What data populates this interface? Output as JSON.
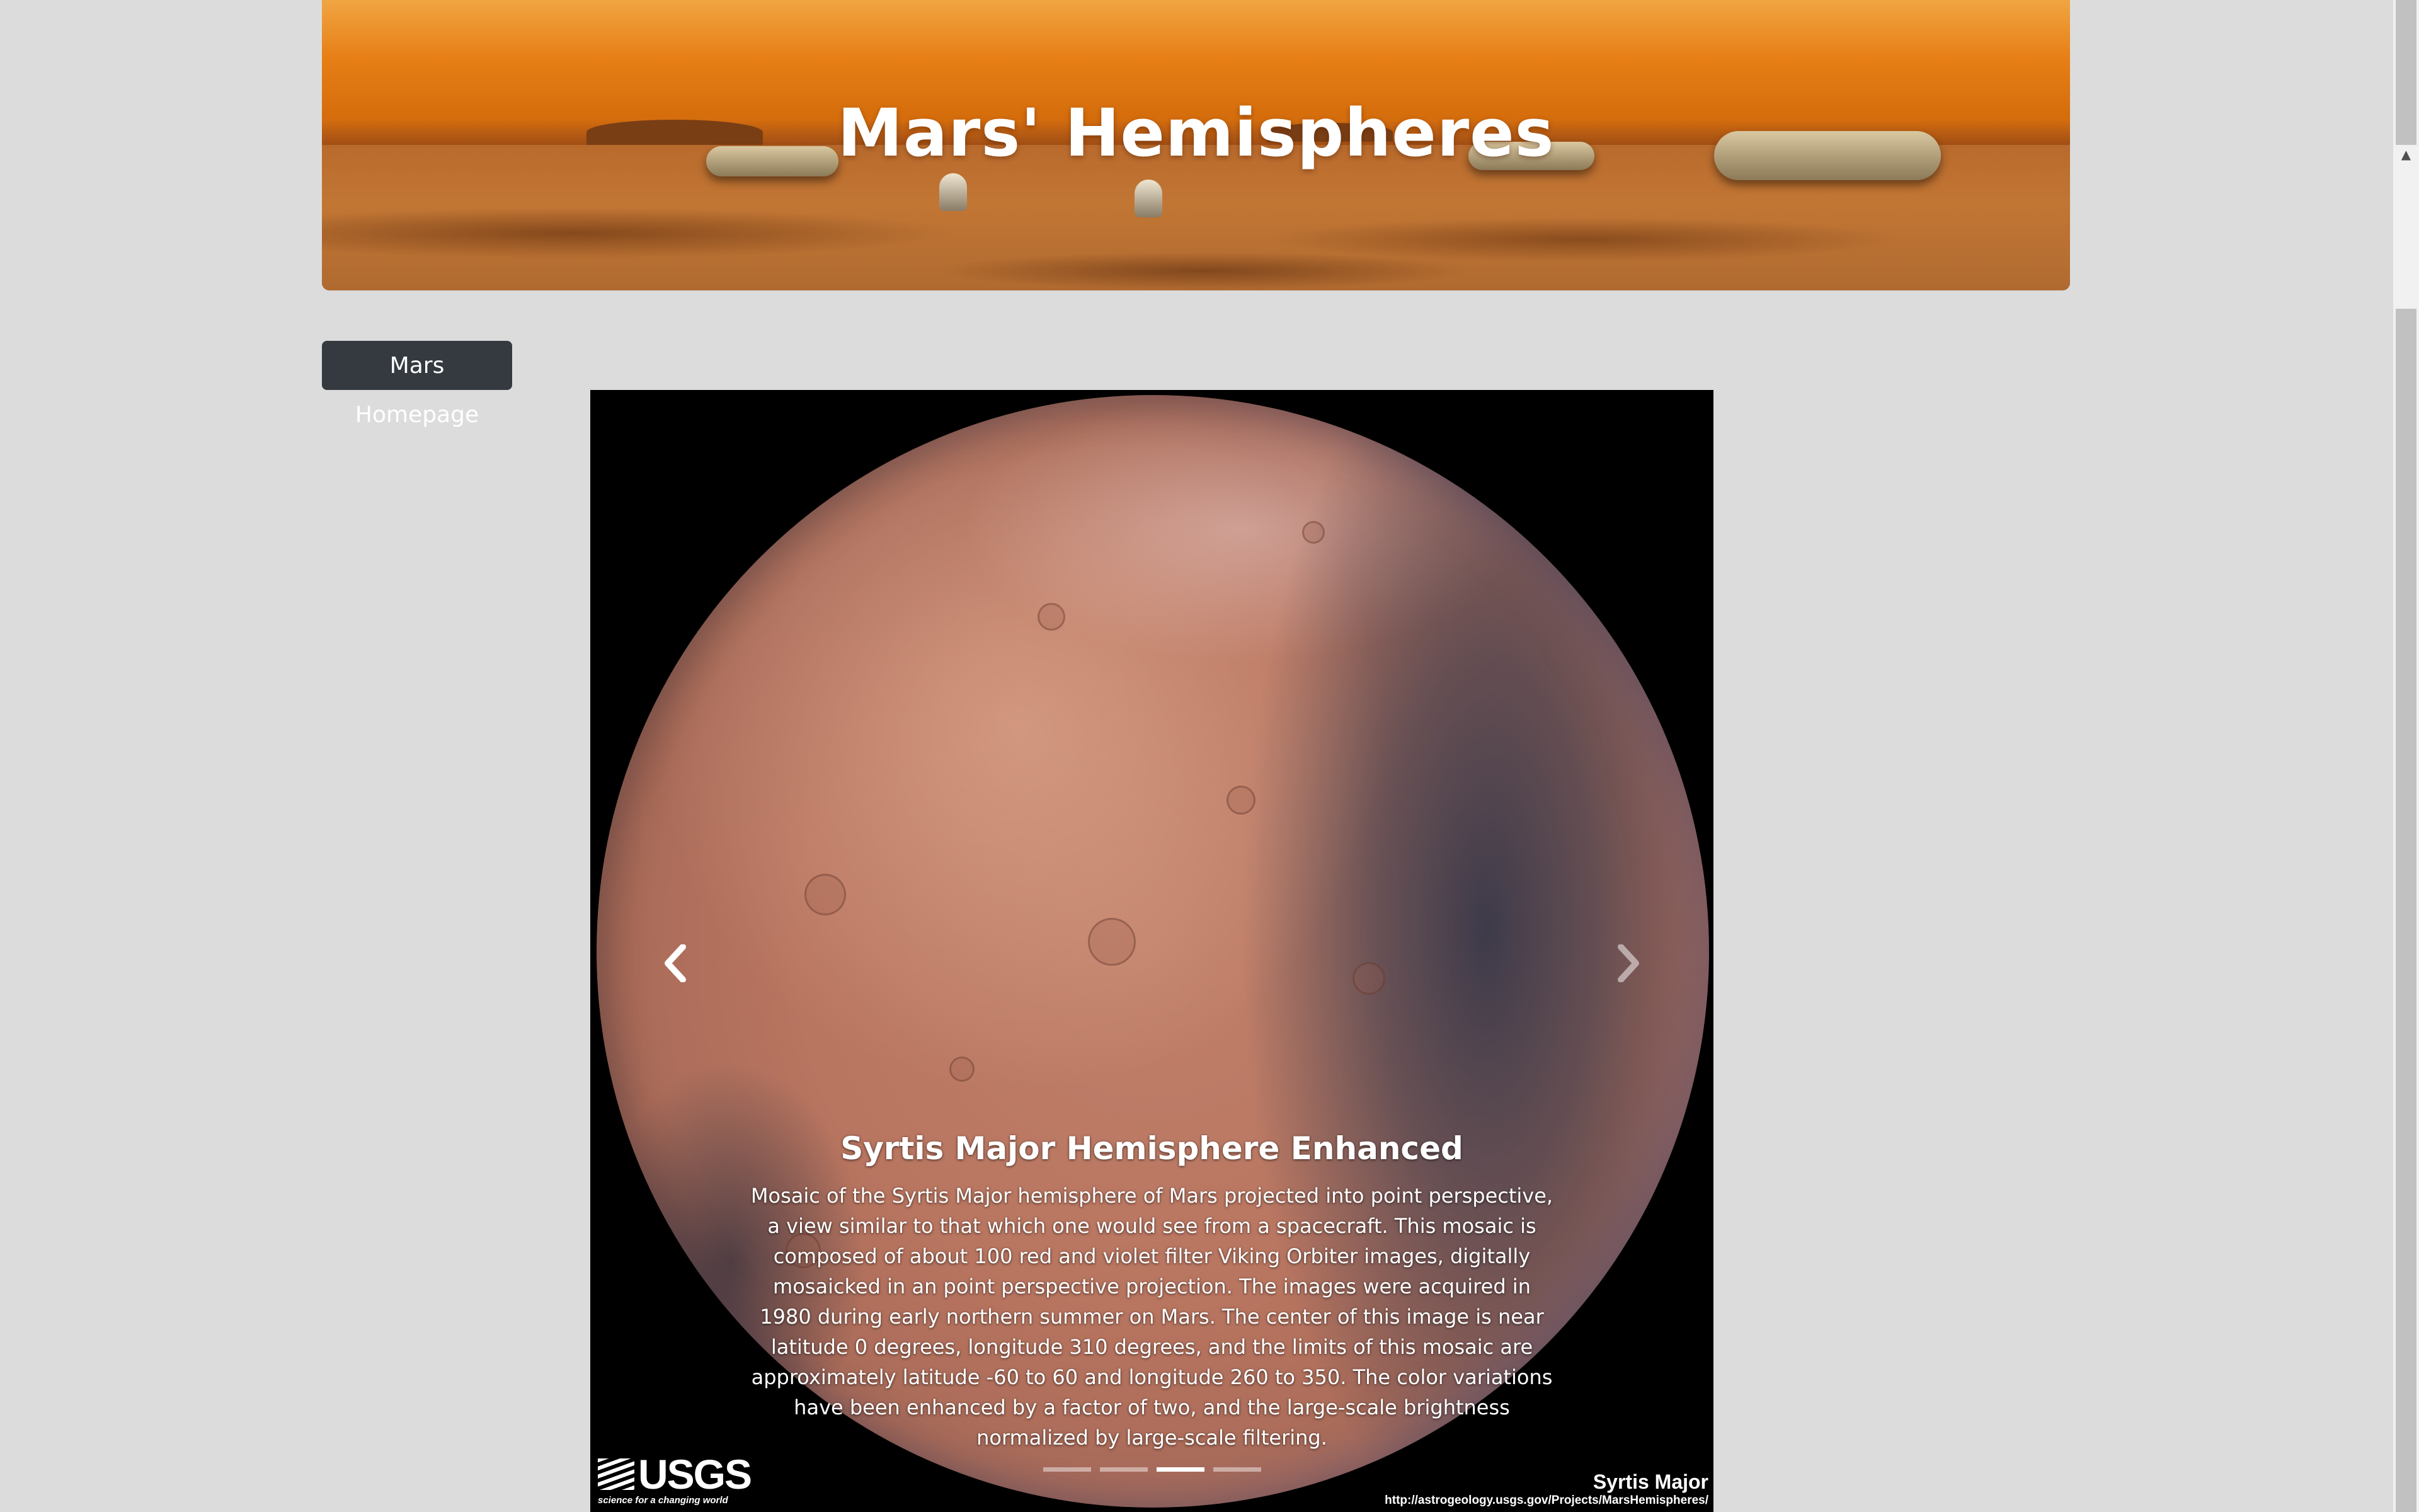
{
  "header": {
    "title": "Mars' Hemispheres"
  },
  "nav": {
    "home_button_label": "Mars Homepage"
  },
  "carousel": {
    "active_index": 2,
    "slide_count": 4,
    "caption_title": "Syrtis Major Hemisphere Enhanced",
    "caption_text": "Mosaic of the Syrtis Major hemisphere of Mars projected into point perspective, a view similar to that which one would see from a spacecraft. This mosaic is composed of about 100 red and violet filter Viking Orbiter images, digitally mosaicked in an point perspective projection. The images were acquired in 1980 during early northern summer on Mars. The center of this image is near latitude 0 degrees, longitude 310 degrees, and the limits of this mosaic are approximately latitude -60 to 60 and longitude 260 to 350. The color variations have been enhanced by a factor of two, and the large-scale brightness normalized by large-scale filtering.",
    "prev_icon": "chevron-left-icon",
    "next_icon": "chevron-right-icon",
    "image_overlay": {
      "logo_text": "USGS",
      "logo_tagline": "science for a changing world",
      "image_name": "Syrtis Major",
      "image_url_text": "http://astrogeology.usgs.gov/Projects/MarsHemispheres/"
    }
  },
  "colors": {
    "page_background": "#dcdcdc",
    "button_background": "#343a40",
    "banner_accent": "#e77f16"
  }
}
